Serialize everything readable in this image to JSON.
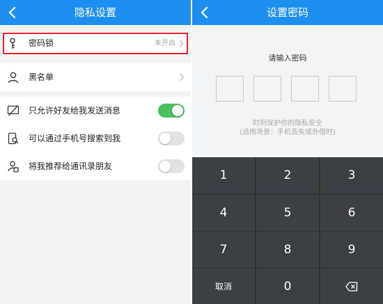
{
  "left_screen": {
    "title": "隐私设置",
    "password_lock": {
      "label": "密码锁",
      "status": "未开启"
    },
    "blacklist": {
      "label": "黑名单"
    },
    "toggles": [
      {
        "label": "只允许好友给我发送消息",
        "on": true
      },
      {
        "label": "可以通过手机号搜索到我",
        "on": false
      },
      {
        "label": "将我推荐给通讯录朋友",
        "on": false
      }
    ]
  },
  "right_screen": {
    "title": "设置密码",
    "prompt": "请输入密码",
    "hint_line1": "时刻保护你的隐私安全",
    "hint_line2": "(适用场景：手机丢失或外借时)",
    "keys": [
      "1",
      "2",
      "3",
      "4",
      "5",
      "6",
      "7",
      "8",
      "9"
    ],
    "cancel_label": "取消",
    "zero_label": "0"
  },
  "colors": {
    "nav_blue": "#1e8ff0",
    "toggle_on": "#4cc05a",
    "highlight_red": "#e8232d",
    "keypad_bg": "#2f3235",
    "key_bg": "#3c3f44"
  },
  "icons": [
    "back-arrow-icon",
    "key-icon",
    "user-icon",
    "no-chat-icon",
    "phone-search-icon",
    "contacts-icon",
    "chevron-right-icon",
    "backspace-icon"
  ]
}
